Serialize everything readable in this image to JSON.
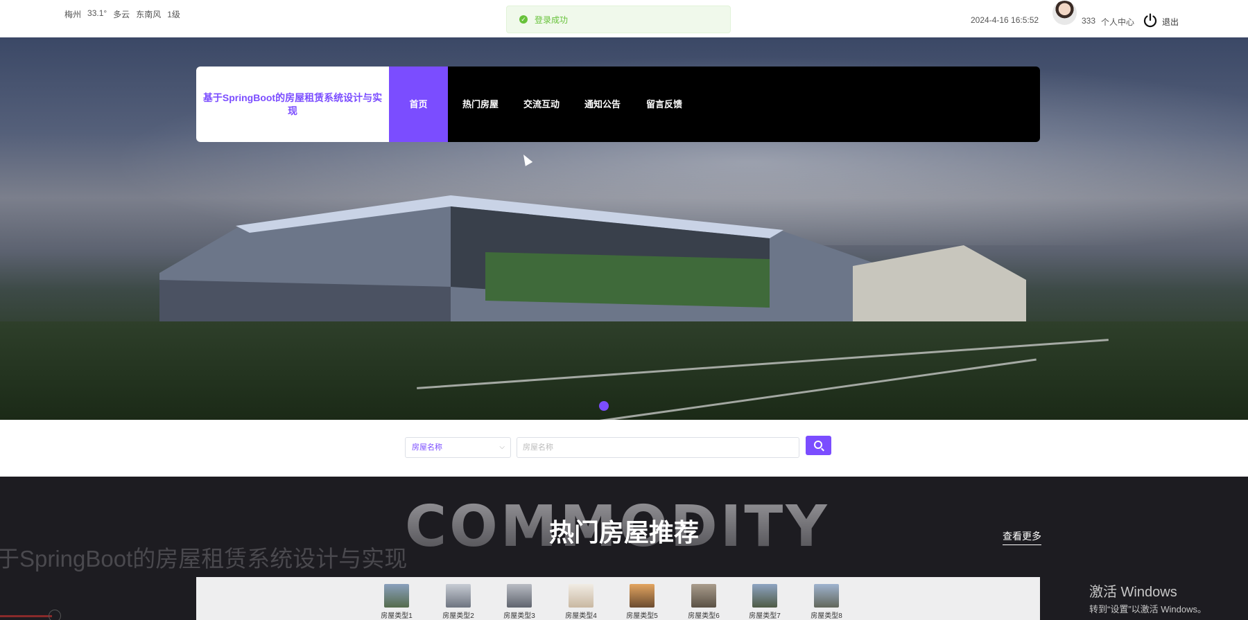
{
  "weather": {
    "city": "梅州",
    "temp": "33.1°",
    "sky": "多云",
    "wind": "东南风",
    "level": "1级"
  },
  "toast": {
    "message": "登录成功",
    "color": "#67c23a"
  },
  "header": {
    "datetime": "2024-4-16 16:5:52",
    "username": "333",
    "profile": "个人中心",
    "logout": "退出"
  },
  "nav": {
    "brand": "基于SpringBoot的房屋租赁系统设计与实现",
    "items": [
      "首页",
      "热门房屋",
      "交流互动",
      "通知公告",
      "留言反馈"
    ],
    "accent": "#7b4dff"
  },
  "search": {
    "select_value": "房屋名称",
    "placeholder": "房屋名称"
  },
  "hot": {
    "bg_word": "COMMODITY",
    "title": "热门房屋推荐",
    "more": "查看更多",
    "ghost": "于SpringBoot的房屋租赁系统设计与实现"
  },
  "categories": [
    "房屋类型1",
    "房屋类型2",
    "房屋类型3",
    "房屋类型4",
    "房屋类型5",
    "房屋类型6",
    "房屋类型7",
    "房屋类型8"
  ],
  "windows": {
    "line1": "激活 Windows",
    "line2": "转到“设置”以激活 Windows。"
  }
}
